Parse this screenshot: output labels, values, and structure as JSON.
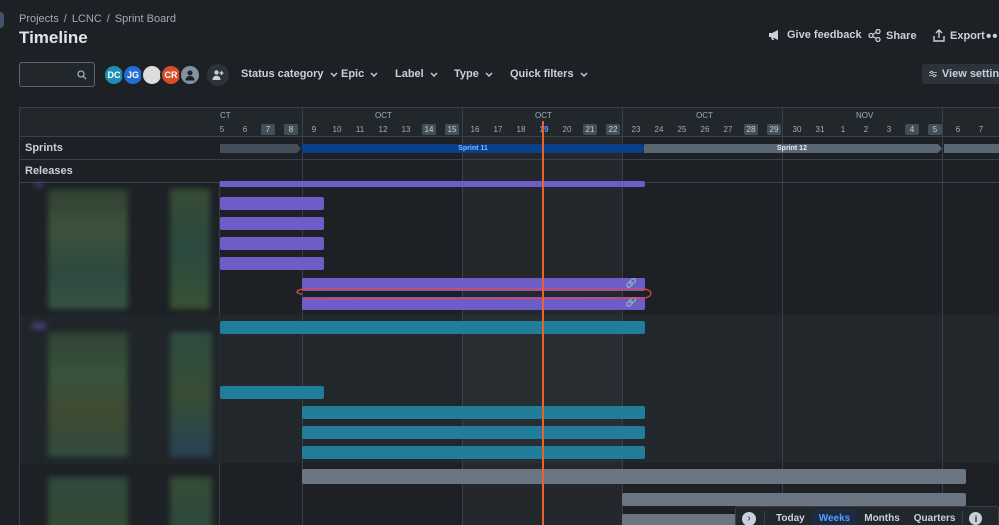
{
  "breadcrumbs": [
    "Projects",
    "LCNC",
    "Sprint Board"
  ],
  "page_title": "Timeline",
  "header_actions": {
    "feedback": "Give feedback",
    "share": "Share",
    "export": "Export",
    "more": "•••"
  },
  "avatars": [
    {
      "initials": "DC",
      "color": "#1d8fb5"
    },
    {
      "initials": "JG",
      "color": "#1f6fd6"
    },
    {
      "initials": "",
      "color": "#dddddd"
    },
    {
      "initials": "CR",
      "color": "#d94c28"
    },
    {
      "initials": "",
      "color": "#8590a2"
    }
  ],
  "filters": {
    "status": "Status category",
    "epic": "Epic",
    "label": "Label",
    "type": "Type",
    "quick": "Quick filters"
  },
  "view_settings": "View settings",
  "rows": {
    "sprints": "Sprints",
    "releases": "Releases"
  },
  "months": [
    "CT",
    "OCT",
    "OCT",
    "OCT",
    "NOV"
  ],
  "days": [
    "5",
    "6",
    "7",
    "8",
    "9",
    "10",
    "11",
    "12",
    "13",
    "14",
    "15",
    "16",
    "17",
    "18",
    "19",
    "20",
    "21",
    "22",
    "23",
    "24",
    "25",
    "26",
    "27",
    "28",
    "29",
    "30",
    "31",
    "1",
    "2",
    "3",
    "4",
    "5",
    "6",
    "7"
  ],
  "weekend_days": [
    2,
    3,
    9,
    10,
    16,
    17,
    23,
    24,
    30,
    31
  ],
  "today_index": 14,
  "sprints": [
    {
      "name": "Sprint 11",
      "color": "#0c3f8a",
      "text_color": "#85b8ff"
    },
    {
      "name": "Sprint 12",
      "color": "#596773",
      "text_color": "#ffffff"
    }
  ],
  "link_glyph": "🔗",
  "zoom": {
    "today": "Today",
    "weeks": "Weeks",
    "months": "Months",
    "quarters": "Quarters",
    "selected": "Weeks"
  },
  "colors": {
    "today_line": "#e8642d",
    "epic_purple": "#6e5dc6",
    "epic_teal": "#227d9b",
    "epic_grey": "#6b7682"
  }
}
